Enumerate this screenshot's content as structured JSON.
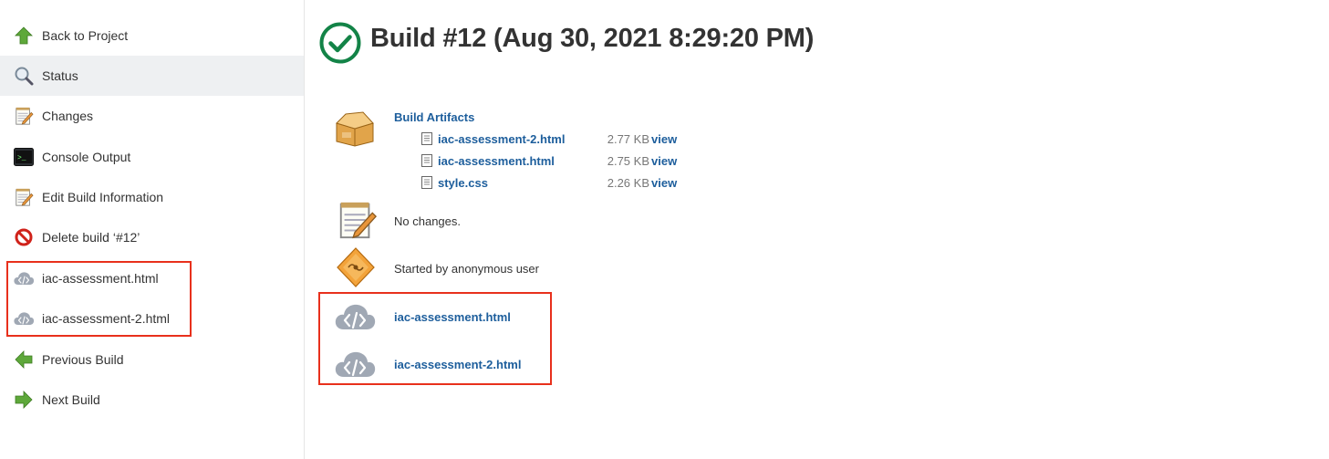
{
  "sidebar": {
    "items": [
      {
        "label": "Back to Project",
        "icon": "up-arrow-icon"
      },
      {
        "label": "Status",
        "icon": "magnifier-icon"
      },
      {
        "label": "Changes",
        "icon": "notepad-icon"
      },
      {
        "label": "Console Output",
        "icon": "terminal-icon"
      },
      {
        "label": "Edit Build Information",
        "icon": "notepad-icon"
      },
      {
        "label": "Delete build ‘#12’",
        "icon": "no-entry-icon"
      },
      {
        "label": "iac-assessment.html",
        "icon": "cloud-code-icon"
      },
      {
        "label": "iac-assessment-2.html",
        "icon": "cloud-code-icon"
      },
      {
        "label": "Previous Build",
        "icon": "left-arrow-icon"
      },
      {
        "label": "Next Build",
        "icon": "right-arrow-icon"
      }
    ],
    "active": "Status"
  },
  "main": {
    "title": "Build #12 (Aug 30, 2021 8:29:20 PM)",
    "artifacts": {
      "heading": "Build Artifacts",
      "files": [
        {
          "name": "iac-assessment-2.html",
          "size": "2.77 KB",
          "view": "view"
        },
        {
          "name": "iac-assessment.html",
          "size": "2.75 KB",
          "view": "view"
        },
        {
          "name": "style.css",
          "size": "2.26 KB",
          "view": "view"
        }
      ]
    },
    "changes_text": "No changes.",
    "cause_text": "Started by anonymous user",
    "reports": [
      {
        "label": "iac-assessment.html"
      },
      {
        "label": "iac-assessment-2.html"
      }
    ]
  },
  "colors": {
    "link": "#1d5e9c",
    "success": "#138347",
    "highlight_box": "#e8301c",
    "active_row": "#eef0f2"
  }
}
